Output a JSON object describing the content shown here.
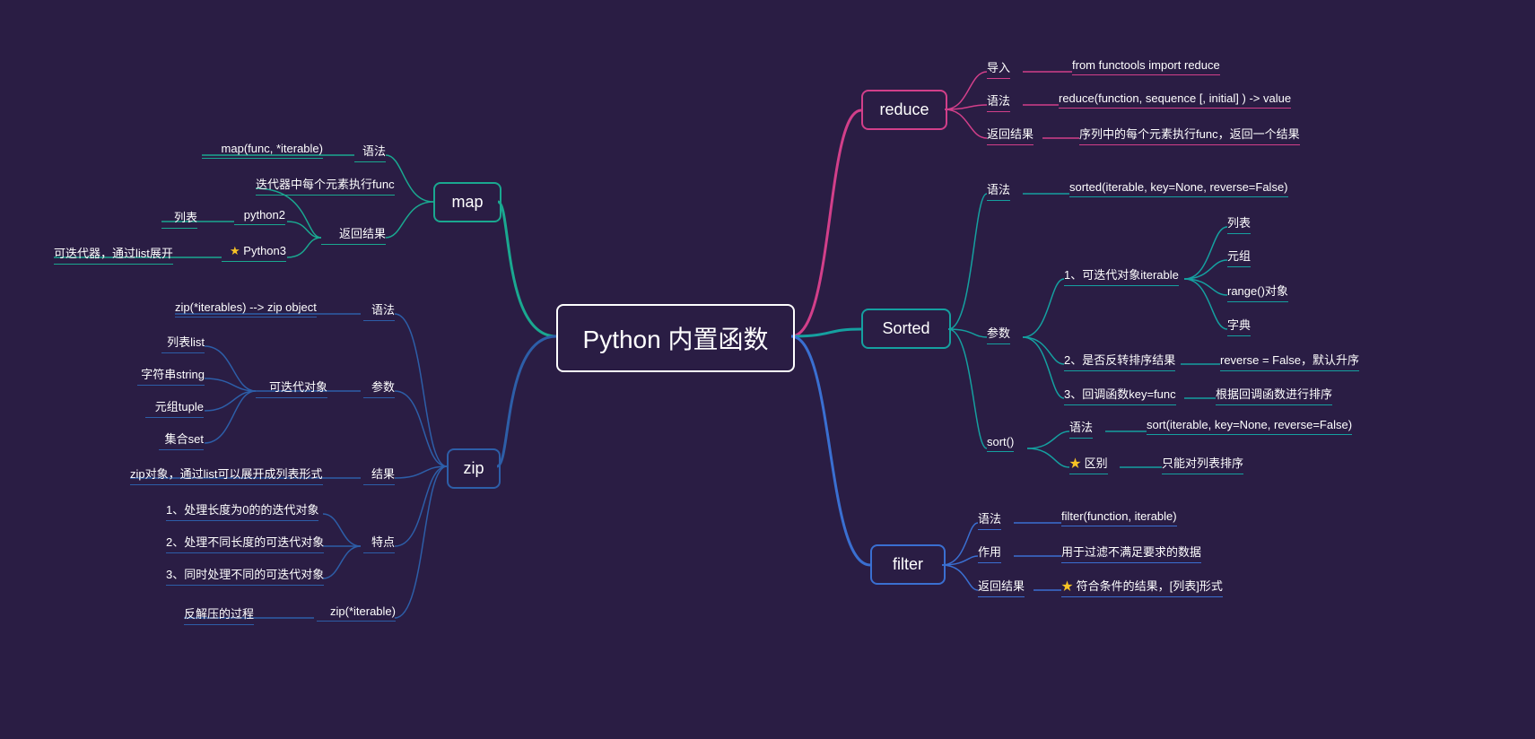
{
  "root": "Python 内置函数",
  "branches": {
    "map": {
      "title": "map",
      "syntax_label": "语法",
      "syntax_value": "map(func, *iterable)",
      "return_label": "返回结果",
      "return_sub1": "迭代器中每个元素执行func",
      "return_sub2_label": "python2",
      "return_sub2_value": "列表",
      "return_sub3_label": "Python3",
      "return_sub3_value": "可迭代器，通过list展开"
    },
    "zip": {
      "title": "zip",
      "syntax_label": "语法",
      "syntax_value": "zip(*iterables) --> zip object",
      "param_label": "参数",
      "param_sub_label": "可迭代对象",
      "param_items": [
        "列表list",
        "字符串string",
        "元组tuple",
        "集合set"
      ],
      "result_label": "结果",
      "result_value": "zip对象，通过list可以展开成列表形式",
      "feature_label": "特点",
      "feature_items": [
        "1、处理长度为0的的迭代对象",
        "2、处理不同长度的可迭代对象",
        "3、同时处理不同的可迭代对象"
      ],
      "unzip_label": "zip(*iterable)",
      "unzip_value": "反解压的过程"
    },
    "reduce": {
      "title": "reduce",
      "import_label": "导入",
      "import_value": "from functools import reduce",
      "syntax_label": "语法",
      "syntax_value": "reduce(function, sequence [, initial] ) -> value",
      "return_label": "返回结果",
      "return_value": "序列中的每个元素执行func，返回一个结果"
    },
    "sorted": {
      "title": "Sorted",
      "syntax_label": "语法",
      "syntax_value": "sorted(iterable, key=None, reverse=False)",
      "param_label": "参数",
      "p1_label": "1、可迭代对象iterable",
      "p1_items": [
        "列表",
        "元组",
        "range()对象",
        "字典"
      ],
      "p2_label": "2、是否反转排序结果",
      "p2_value": "reverse = False，默认升序",
      "p3_label": "3、回调函数key=func",
      "p3_value": "根据回调函数进行排序",
      "sort_label": "sort()",
      "sort_syntax_label": "语法",
      "sort_syntax_value": "sort(iterable, key=None, reverse=False)",
      "sort_diff_label": "区别",
      "sort_diff_value": "只能对列表排序"
    },
    "filter": {
      "title": "filter",
      "syntax_label": "语法",
      "syntax_value": "filter(function, iterable)",
      "role_label": "作用",
      "role_value": "用于过滤不满足要求的数据",
      "return_label": "返回结果",
      "return_value": "符合条件的结果，[列表]形式"
    }
  }
}
